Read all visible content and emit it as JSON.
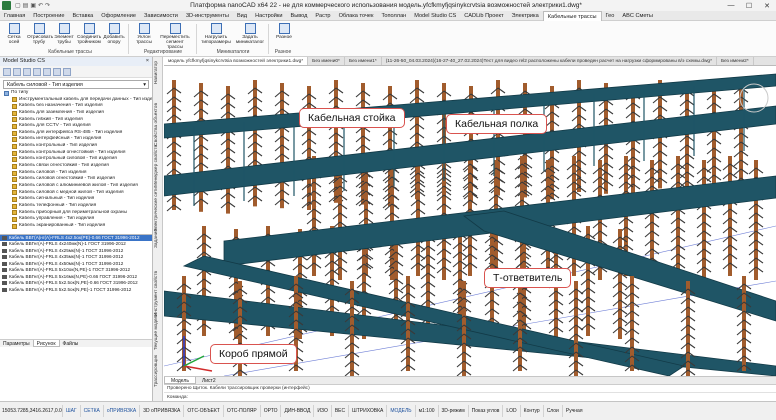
{
  "window": {
    "title": "Платформа nanoCAD x64 22 - не для коммерческого использования модель.yfcfkmyfjqsinykcrvtsia возможностей электрики1.dwg*",
    "controls": [
      "—",
      "☐",
      "✕"
    ]
  },
  "menu_tabs": [
    "Главная",
    "Построение",
    "Вставка",
    "Оформление",
    "Зависимости",
    "3D-инструменты",
    "Вид",
    "Настройки",
    "Вывод",
    "Растр",
    "Облака точек",
    "Тополлан",
    "Model Studio CS",
    "CADLib Проект",
    "Электрика",
    "Кабельные трассы",
    "Гео",
    "ABC Сметы"
  ],
  "active_menu_tab": "Кабельные трассы",
  "ribbon": {
    "buttons": [
      "Сетка осей",
      "Отрисовать трубу",
      "Элемент трубы",
      "Соединить тройником",
      "Добавить опору",
      "Уклон трассы",
      "Переместить сегмент трассы",
      "Нагрузить типоразмеры",
      "Задать миникаталог",
      "Разное"
    ],
    "groups": [
      "Кабельные трассы",
      "Редактирование",
      "Миникаталоги",
      "Разное"
    ]
  },
  "left_panel": {
    "title": "Model Studio CS",
    "combo": "Кабель силовой - Тип изделия",
    "tree": [
      "По типу",
      "Инструментальный кабель для передачи данных - Тип изделия",
      "Кабель без назначения - Тип изделия",
      "Кабель для заземления - Тип изделия",
      "Кабель гибкий - Тип изделия",
      "Кабель для CCTV - Тип изделия",
      "Кабель для интерфейса RS-485 - Тип изделия",
      "Кабель интерфейсный - Тип изделия",
      "Кабель контрольный - Тип изделия",
      "Кабель контрольный огнестойкий - Тип изделия",
      "Кабель контрольный силовой - Тип изделия",
      "Кабель связи огнестойкий - Тип изделия",
      "Кабель силовой - Тип изделия",
      "Кабель силовой огнестойкий - Тип изделия",
      "Кабель силовой с алюминиевой жилой - Тип изделия",
      "Кабель силовой с медной жилой - Тип изделия",
      "Кабель сигнальный - Тип изделия",
      "Кабель телефонный - Тип изделия",
      "Кабель приборный для периметральной охраны",
      "Кабель управления - Тип изделия",
      "Кабель экранированный - Тип изделия"
    ],
    "cable_list": [
      "Кабель ВВГ(А)нг(А)-FRLS 4x2.5ок(PE)-0.66 ГОСТ 31996-2012",
      "Кабель ВВГнг(А)-FRLS 4x240мк(N)-1 ГОСТ 31996-2012",
      "Кабель ВВГнг(А)-FRLS 4x25мк(N)-1 ГОСТ 31996-2012",
      "Кабель ВВГнг(А)-FRLS 4x35мк(N)-1 ГОСТ 31996-2012",
      "Кабель ВВГнг(А)-FRLS 4x50мк(N)-1 ГОСТ 31996-2012",
      "Кабель ВВГнг(А)-FRLS 5x10ок(N,PE)-1 ГОСТ 31996-2012",
      "Кабель ВВГнг(А)-FRLS 5x16мк(N,PE)-0.66 ГОСТ 31996-2012",
      "Кабель ВВГнг(А)-FRLS 5x2.5ок(N,PE)-0.66 ГОСТ 31996-2012",
      "Кабель ВВГнг(А)-FRLS 5x2.5ок(N,PE)-1 ГОСТ 31996-2012"
    ],
    "tabs": [
      "Параметры",
      "Рисунок",
      "Файлы"
    ]
  },
  "vertical_tabs": [
    "Навигатор",
    "Свойства объектов",
    "Менеджер свойств",
    "Электрические сети",
    "Задание",
    "Инструмент свойств",
    "Текущие модели",
    "Трассировщик"
  ],
  "doc_tabs": [
    "модель yfcfkmyfjqsinykcrvtsia возможностей электрики1.dwg*",
    "Без имени0*",
    "Без имени1*",
    "(11-26-50_04.03.2024)(16-27-40_27.02.2024)Тест для видео rel2 расположены кабели проведен расчет на нагрузки сформированы в/э схемы.dwg*",
    "Без имени2*"
  ],
  "callouts": {
    "cable_stand": "Кабельная стойка",
    "cable_shelf": "Кабельная полка",
    "t_branch": "Т-ответвитель",
    "straight_box": "Короб прямой"
  },
  "model_tabs": [
    "Модель",
    "Лист2"
  ],
  "command_line": {
    "history": "Проверено Щиток. Кабели трассировщик проверки (интерфейс)",
    "prompt": "Команда:"
  },
  "status": {
    "coords": "15053.7285,3416.2617,0.0000",
    "items": [
      "ШАГ",
      "СЕТКА",
      "оПРИВЯЗКА",
      "3D оПРИВЯЗКА",
      "ОТС-ОБЪЕКТ",
      "ОТС-ПОЛЯР",
      "ОРТО",
      "ДИН-ВВОД",
      "ИЗО",
      "ВЕС",
      "ШТРИХОВКА",
      "МОДЕЛЬ",
      "м1:100",
      "3D-режим",
      "Показ углов",
      "LOD",
      "Контур",
      "Слои",
      "Ручная"
    ]
  },
  "colors": {
    "tray": "#1f5566",
    "tray_dark": "#123a47",
    "post": "#a15c2d",
    "spike": "#3a3a3a",
    "callout_border": "#d9534f"
  }
}
